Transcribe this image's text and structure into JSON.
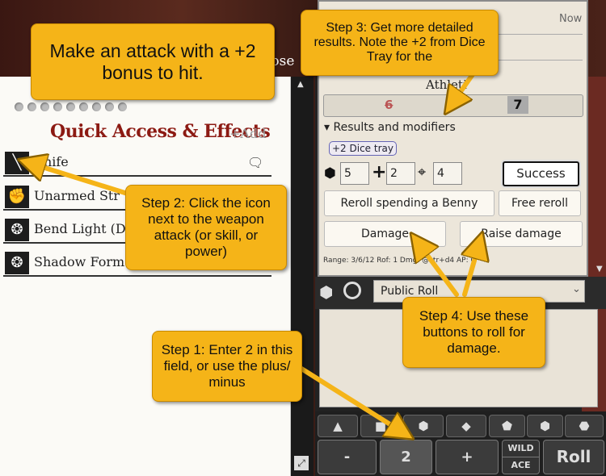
{
  "window": {
    "close_label": "lose"
  },
  "sheet": {
    "title": "Quick Access & Effects",
    "add_label": "+Add",
    "items": [
      {
        "label": "Knife",
        "icon": "knife-icon",
        "glyph": "╲"
      },
      {
        "label": "Unarmed Str",
        "icon": "fist-icon",
        "glyph": "✊"
      },
      {
        "label": "Bend Light (Di",
        "icon": "power-icon",
        "glyph": "❂"
      },
      {
        "label": "Shadow Form",
        "icon": "power-icon",
        "glyph": "❂"
      }
    ]
  },
  "card": {
    "timestamp": "Now",
    "skill": "Athleti",
    "old_roll": "6",
    "new_roll": "7",
    "results_label": "Results and modifiers",
    "dice_tray_tag": "+2 Dice tray",
    "modifiers": [
      "5",
      "2",
      "4"
    ],
    "success": "Success",
    "reroll_benny": "Reroll spending a Benny",
    "free_reroll": "Free reroll",
    "damage": "Damage",
    "raise_damage": "Raise damage",
    "footer": "Range: 3/6/12   Rof: 1   Dmg: @str+d4   AP: 0"
  },
  "chat": {
    "roll_mode": "Public Roll",
    "dice_buttons": [
      "▲",
      "■",
      "⬢",
      "◆",
      "⬟",
      "⬢",
      "⬣"
    ],
    "minus": "-",
    "modifier_value": "2",
    "plus": "+",
    "wild": "WILD",
    "ace": "ACE",
    "roll": "Roll"
  },
  "callouts": {
    "attack": "Make an attack with a +2 bonus to hit.",
    "step1": "Step 1: Enter 2 in this field, or use the plus/ minus",
    "step2": "Step 2: Click the icon next to the weapon attack (or skill, or power)",
    "step3": "Step 3: Get more detailed results. Note the +2 from Dice Tray for the",
    "step4": "Step 4: Use these buttons to roll for damage."
  },
  "colors": {
    "callout": "#f5b418",
    "title": "#8c1a13",
    "arrow": "#f5b418"
  }
}
